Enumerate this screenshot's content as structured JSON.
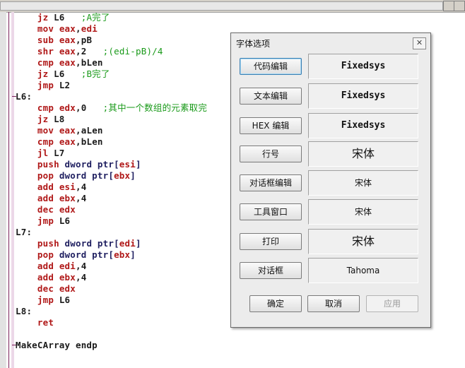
{
  "editor": {
    "lines": [
      [
        {
          "t": "    "
        },
        {
          "c": "ins",
          "t": "jz"
        },
        {
          "c": "lbl",
          "t": " L6   "
        },
        {
          "c": "cmt",
          "t": ";A完了"
        }
      ],
      [
        {
          "t": "    "
        },
        {
          "c": "ins",
          "t": "mov"
        },
        {
          "t": " "
        },
        {
          "c": "reg",
          "t": "eax"
        },
        {
          "c": "lbl",
          "t": ","
        },
        {
          "c": "reg",
          "t": "edi"
        }
      ],
      [
        {
          "t": "    "
        },
        {
          "c": "ins",
          "t": "sub"
        },
        {
          "t": " "
        },
        {
          "c": "reg",
          "t": "eax"
        },
        {
          "c": "lbl",
          "t": ",pB"
        }
      ],
      [
        {
          "t": "    "
        },
        {
          "c": "ins",
          "t": "shr"
        },
        {
          "t": " "
        },
        {
          "c": "reg",
          "t": "eax"
        },
        {
          "c": "lbl",
          "t": ",2   "
        },
        {
          "c": "cmt",
          "t": ";(edi-pB)/4"
        }
      ],
      [
        {
          "t": "    "
        },
        {
          "c": "ins",
          "t": "cmp"
        },
        {
          "t": " "
        },
        {
          "c": "reg",
          "t": "eax"
        },
        {
          "c": "lbl",
          "t": ",bLen"
        }
      ],
      [
        {
          "t": "    "
        },
        {
          "c": "ins",
          "t": "jz"
        },
        {
          "c": "lbl",
          "t": " L6   "
        },
        {
          "c": "cmt",
          "t": ";B完了"
        }
      ],
      [
        {
          "t": "    "
        },
        {
          "c": "ins",
          "t": "jmp"
        },
        {
          "c": "lbl",
          "t": " L2"
        }
      ],
      [
        {
          "c": "lbl",
          "t": "L6:"
        }
      ],
      [
        {
          "t": "    "
        },
        {
          "c": "ins",
          "t": "cmp"
        },
        {
          "t": " "
        },
        {
          "c": "reg",
          "t": "edx"
        },
        {
          "c": "lbl",
          "t": ",0   "
        },
        {
          "c": "cmt",
          "t": ";其中一个数组的元素取完"
        }
      ],
      [
        {
          "t": "    "
        },
        {
          "c": "ins",
          "t": "jz"
        },
        {
          "c": "lbl",
          "t": " L8"
        }
      ],
      [
        {
          "t": "    "
        },
        {
          "c": "ins",
          "t": "mov"
        },
        {
          "t": " "
        },
        {
          "c": "reg",
          "t": "eax"
        },
        {
          "c": "lbl",
          "t": ",aLen"
        }
      ],
      [
        {
          "t": "    "
        },
        {
          "c": "ins",
          "t": "cmp"
        },
        {
          "t": " "
        },
        {
          "c": "reg",
          "t": "eax"
        },
        {
          "c": "lbl",
          "t": ",bLen"
        }
      ],
      [
        {
          "t": "    "
        },
        {
          "c": "ins",
          "t": "jl"
        },
        {
          "c": "lbl",
          "t": " L7"
        }
      ],
      [
        {
          "t": "    "
        },
        {
          "c": "ins",
          "t": "push"
        },
        {
          "c": "kw",
          "t": " dword ptr["
        },
        {
          "c": "reg",
          "t": "esi"
        },
        {
          "c": "kw",
          "t": "]"
        }
      ],
      [
        {
          "t": "    "
        },
        {
          "c": "ins",
          "t": "pop"
        },
        {
          "c": "kw",
          "t": " dword ptr["
        },
        {
          "c": "reg",
          "t": "ebx"
        },
        {
          "c": "kw",
          "t": "]"
        }
      ],
      [
        {
          "t": "    "
        },
        {
          "c": "ins",
          "t": "add"
        },
        {
          "t": " "
        },
        {
          "c": "reg",
          "t": "esi"
        },
        {
          "c": "lbl",
          "t": ",4"
        }
      ],
      [
        {
          "t": "    "
        },
        {
          "c": "ins",
          "t": "add"
        },
        {
          "t": " "
        },
        {
          "c": "reg",
          "t": "ebx"
        },
        {
          "c": "lbl",
          "t": ",4"
        }
      ],
      [
        {
          "t": "    "
        },
        {
          "c": "ins",
          "t": "dec"
        },
        {
          "t": " "
        },
        {
          "c": "reg",
          "t": "edx"
        }
      ],
      [
        {
          "t": "    "
        },
        {
          "c": "ins",
          "t": "jmp"
        },
        {
          "c": "lbl",
          "t": " L6"
        }
      ],
      [
        {
          "c": "lbl",
          "t": "L7:"
        }
      ],
      [
        {
          "t": "    "
        },
        {
          "c": "ins",
          "t": "push"
        },
        {
          "c": "kw",
          "t": " dword ptr["
        },
        {
          "c": "reg",
          "t": "edi"
        },
        {
          "c": "kw",
          "t": "]"
        }
      ],
      [
        {
          "t": "    "
        },
        {
          "c": "ins",
          "t": "pop"
        },
        {
          "c": "kw",
          "t": " dword ptr["
        },
        {
          "c": "reg",
          "t": "ebx"
        },
        {
          "c": "kw",
          "t": "]"
        }
      ],
      [
        {
          "t": "    "
        },
        {
          "c": "ins",
          "t": "add"
        },
        {
          "t": " "
        },
        {
          "c": "reg",
          "t": "edi"
        },
        {
          "c": "lbl",
          "t": ",4"
        }
      ],
      [
        {
          "t": "    "
        },
        {
          "c": "ins",
          "t": "add"
        },
        {
          "t": " "
        },
        {
          "c": "reg",
          "t": "ebx"
        },
        {
          "c": "lbl",
          "t": ",4"
        }
      ],
      [
        {
          "t": "    "
        },
        {
          "c": "ins",
          "t": "dec"
        },
        {
          "t": " "
        },
        {
          "c": "reg",
          "t": "edx"
        }
      ],
      [
        {
          "t": "    "
        },
        {
          "c": "ins",
          "t": "jmp"
        },
        {
          "c": "lbl",
          "t": " L6"
        }
      ],
      [
        {
          "c": "lbl",
          "t": "L8:"
        }
      ],
      [
        {
          "t": "    "
        },
        {
          "c": "ins",
          "t": "ret"
        }
      ],
      [],
      [
        {
          "c": "lbl",
          "t": "MakeCArray endp"
        }
      ]
    ]
  },
  "dialog": {
    "title": "字体选项",
    "close_glyph": "✕",
    "rows": [
      {
        "button": "代码编辑",
        "preview": "Fixedsys",
        "style": "p-fixed"
      },
      {
        "button": "文本编辑",
        "preview": "Fixedsys",
        "style": "p-fixed"
      },
      {
        "button": "HEX 编辑",
        "preview": "Fixedsys",
        "style": "p-fixed"
      },
      {
        "button": "行号",
        "preview": "宋体",
        "style": "p-song-lg"
      },
      {
        "button": "对话框编辑",
        "preview": "宋体",
        "style": "p-song-sm"
      },
      {
        "button": "工具窗口",
        "preview": "宋体",
        "style": "p-song-sm"
      },
      {
        "button": "打印",
        "preview": "宋体",
        "style": "p-song-lg"
      },
      {
        "button": "对话框",
        "preview": "Tahoma",
        "style": "p-tahoma"
      }
    ],
    "ok_label": "确定",
    "cancel_label": "取消",
    "apply_label": "应用",
    "apply_enabled": false
  }
}
